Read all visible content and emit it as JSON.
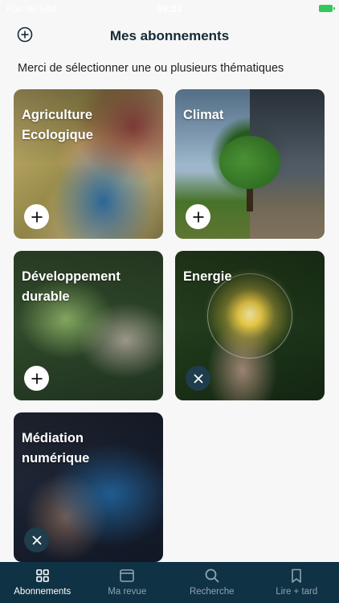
{
  "status_bar": {
    "carrier": "Pas de SIM",
    "time": "09:23"
  },
  "header": {
    "title": "Mes abonnements",
    "add_icon": "plus-circle-icon"
  },
  "subtitle": "Merci de sélectionner une ou plusieurs thématiques",
  "themes": [
    {
      "title": "Agriculture Ecologique",
      "subscribed": false,
      "action_icon": "plus-icon"
    },
    {
      "title": "Climat",
      "subscribed": false,
      "action_icon": "plus-icon"
    },
    {
      "title": "Développement durable",
      "subscribed": false,
      "action_icon": "plus-icon"
    },
    {
      "title": "Energie",
      "subscribed": true,
      "action_icon": "close-icon"
    },
    {
      "title": "Médiation numérique",
      "subscribed": true,
      "action_icon": "close-icon"
    }
  ],
  "tabbar": {
    "background": "#0f3244",
    "items": [
      {
        "label": "Abonnements",
        "icon": "grid-icon",
        "active": true
      },
      {
        "label": "Ma revue",
        "icon": "browser-window-icon",
        "active": false
      },
      {
        "label": "Recherche",
        "icon": "search-icon",
        "active": false
      },
      {
        "label": "Lire + tard",
        "icon": "bookmark-icon",
        "active": false
      }
    ]
  },
  "colors": {
    "primary_dark": "#0f3244",
    "remove_button": "#1f3d4c",
    "battery": "#35c759"
  }
}
